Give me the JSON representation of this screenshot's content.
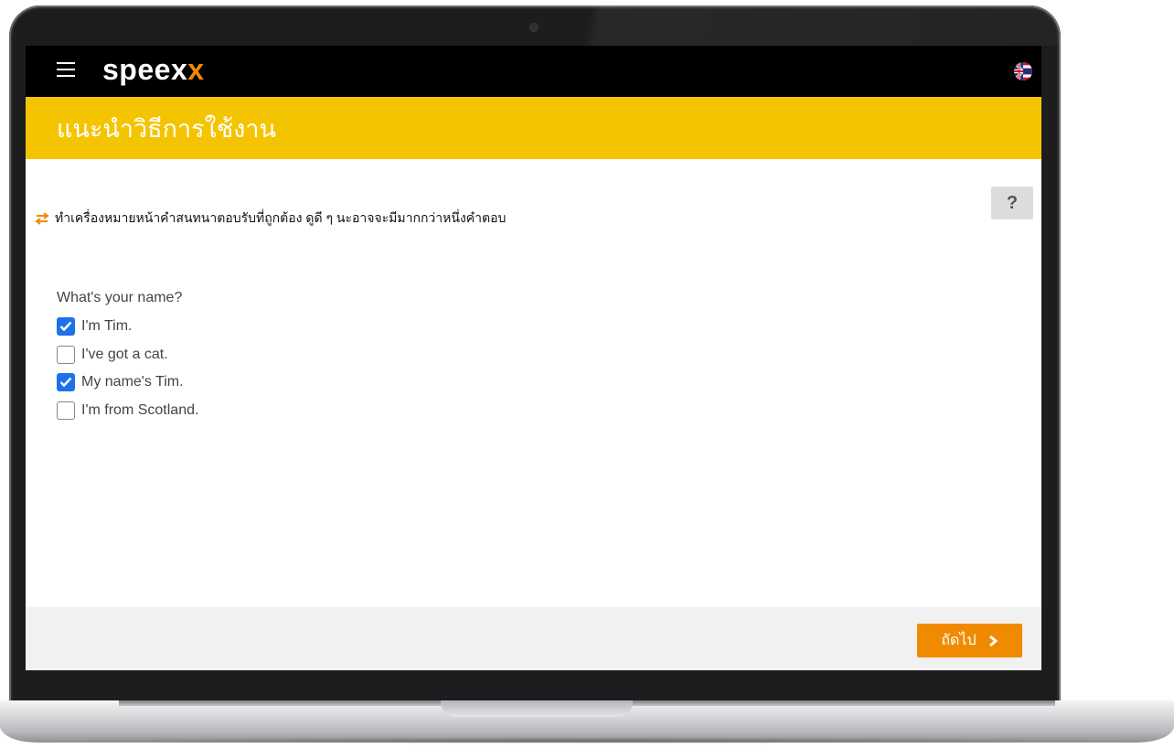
{
  "header": {
    "logo_text": "speex",
    "logo_accent": "x",
    "flag_icon": "uk-thai-flag-icon"
  },
  "banner": {
    "title": "แนะนำวิธีการใช้งาน"
  },
  "help": {
    "label": "?"
  },
  "instruction": {
    "text": "ทำเครื่องหมายหน้าคำสนทนาตอบรับที่ถูกต้อง ดูดี ๆ นะอาจจะมีมากกว่าหนึ่งคำตอบ",
    "icon": "swap-arrows-icon"
  },
  "exercise": {
    "question": "What's your name?",
    "options": [
      {
        "label": "I'm Tim.",
        "checked": true
      },
      {
        "label": "I've got a cat.",
        "checked": false
      },
      {
        "label": "My name's Tim.",
        "checked": true
      },
      {
        "label": "I'm from Scotland.",
        "checked": false
      }
    ]
  },
  "footer": {
    "next_label": "ถัดไป"
  },
  "colors": {
    "brand_orange": "#f08a00",
    "banner_yellow": "#f5c400",
    "checkbox_blue": "#1e72e8",
    "topbar": "#000000"
  }
}
